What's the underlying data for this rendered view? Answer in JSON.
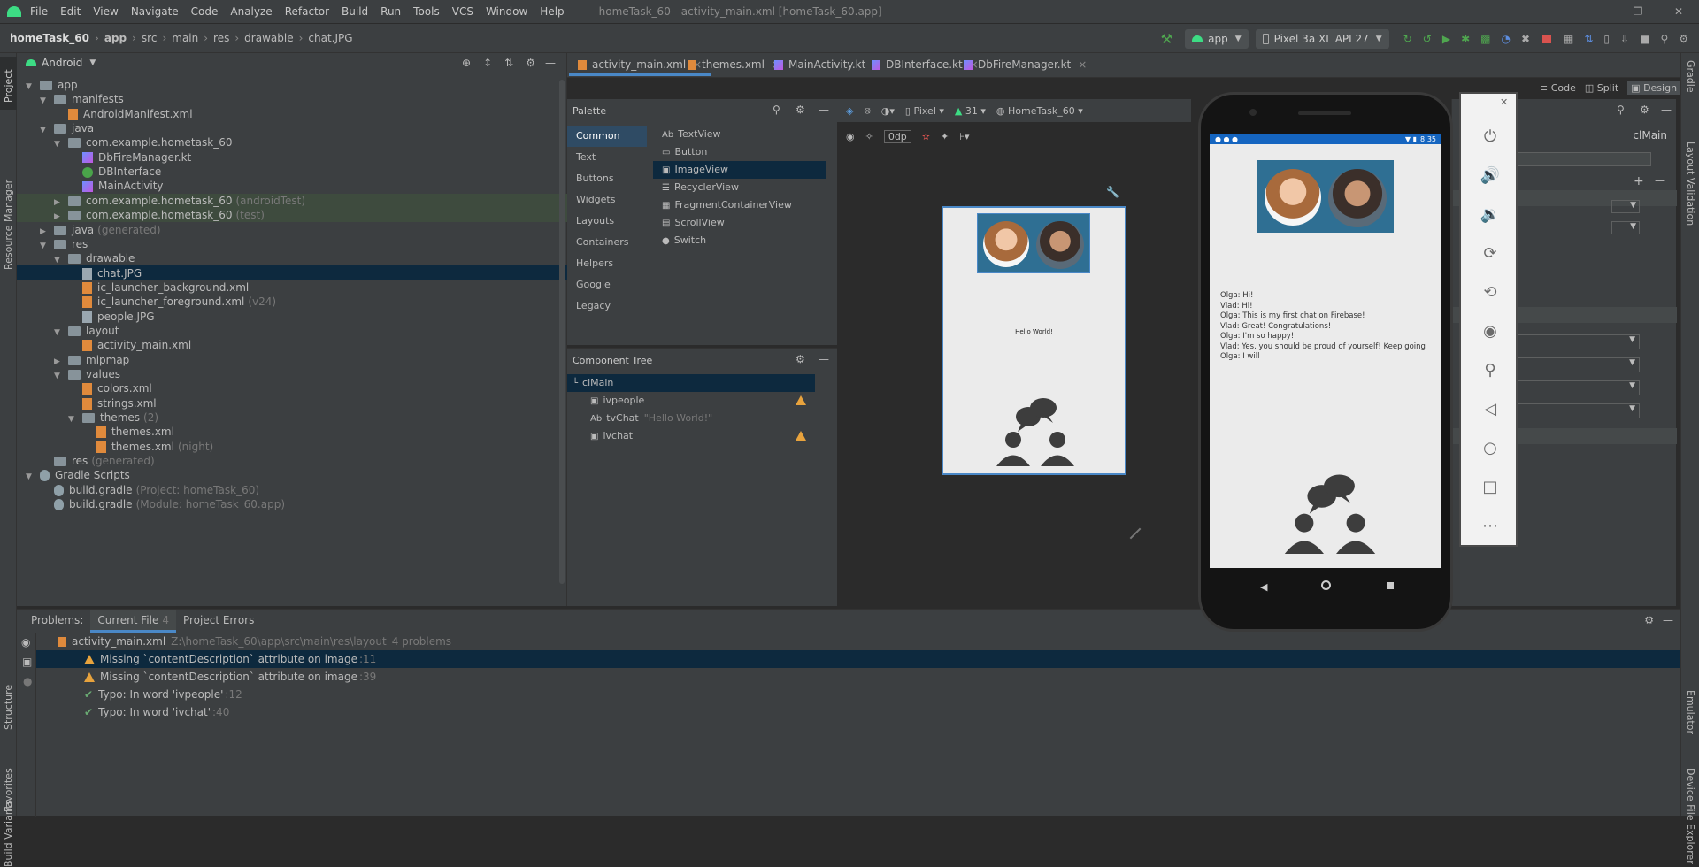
{
  "window": {
    "title": "homeTask_60 - activity_main.xml [homeTask_60.app]",
    "menu": [
      "File",
      "Edit",
      "View",
      "Navigate",
      "Code",
      "Analyze",
      "Refactor",
      "Build",
      "Run",
      "Tools",
      "VCS",
      "Window",
      "Help"
    ]
  },
  "breadcrumb": [
    "homeTask_60",
    "app",
    "src",
    "main",
    "res",
    "drawable",
    "chat.JPG"
  ],
  "toolbar": {
    "run_config": "app",
    "device": "Pixel 3a XL API 27"
  },
  "sidebar_left": [
    "Project",
    "Resource Manager",
    "Structure",
    "Favorites",
    "Build Variants"
  ],
  "sidebar_right": [
    "Gradle",
    "Layout Validation",
    "Emulator",
    "Device File Explorer"
  ],
  "project": {
    "view": "Android",
    "items": [
      {
        "label": "app",
        "depth": 0,
        "kind": "folder",
        "arrow": "down"
      },
      {
        "label": "manifests",
        "depth": 1,
        "kind": "folder",
        "arrow": "down"
      },
      {
        "label": "AndroidManifest.xml",
        "depth": 2,
        "kind": "xml"
      },
      {
        "label": "java",
        "depth": 1,
        "kind": "folder",
        "arrow": "down"
      },
      {
        "label": "com.example.hometask_60",
        "depth": 2,
        "kind": "folder",
        "arrow": "down"
      },
      {
        "label": "DbFireManager.kt",
        "depth": 3,
        "kind": "kt"
      },
      {
        "label": "DBInterface",
        "depth": 3,
        "kind": "iface"
      },
      {
        "label": "MainActivity",
        "depth": 3,
        "kind": "kt"
      },
      {
        "label": "com.example.hometask_60",
        "suffix": "(androidTest)",
        "depth": 2,
        "kind": "folder",
        "arrow": "right",
        "hl": true
      },
      {
        "label": "com.example.hometask_60",
        "suffix": "(test)",
        "depth": 2,
        "kind": "folder",
        "arrow": "right",
        "hl": true
      },
      {
        "label": "java",
        "suffix": "(generated)",
        "depth": 1,
        "kind": "folder",
        "arrow": "right"
      },
      {
        "label": "res",
        "depth": 1,
        "kind": "folder",
        "arrow": "down"
      },
      {
        "label": "drawable",
        "depth": 2,
        "kind": "folder",
        "arrow": "down"
      },
      {
        "label": "chat.JPG",
        "depth": 3,
        "kind": "file",
        "sel": true
      },
      {
        "label": "ic_launcher_background.xml",
        "depth": 3,
        "kind": "xml"
      },
      {
        "label": "ic_launcher_foreground.xml",
        "suffix": "(v24)",
        "depth": 3,
        "kind": "xml"
      },
      {
        "label": "people.JPG",
        "depth": 3,
        "kind": "file"
      },
      {
        "label": "layout",
        "depth": 2,
        "kind": "folder",
        "arrow": "down"
      },
      {
        "label": "activity_main.xml",
        "depth": 3,
        "kind": "xml"
      },
      {
        "label": "mipmap",
        "depth": 2,
        "kind": "folder",
        "arrow": "right"
      },
      {
        "label": "values",
        "depth": 2,
        "kind": "folder",
        "arrow": "down"
      },
      {
        "label": "colors.xml",
        "depth": 3,
        "kind": "xml"
      },
      {
        "label": "strings.xml",
        "depth": 3,
        "kind": "xml"
      },
      {
        "label": "themes",
        "suffix": "(2)",
        "depth": 3,
        "kind": "folder",
        "arrow": "down"
      },
      {
        "label": "themes.xml",
        "depth": 4,
        "kind": "xml"
      },
      {
        "label": "themes.xml",
        "suffix": "(night)",
        "depth": 4,
        "kind": "xml"
      },
      {
        "label": "res",
        "suffix": "(generated)",
        "depth": 1,
        "kind": "folder"
      },
      {
        "label": "Gradle Scripts",
        "depth": 0,
        "kind": "gradle",
        "arrow": "down"
      },
      {
        "label": "build.gradle",
        "suffix": "(Project: homeTask_60)",
        "depth": 1,
        "kind": "gradle"
      },
      {
        "label": "build.gradle",
        "suffix": "(Module: homeTask_60.app)",
        "depth": 1,
        "kind": "gradle"
      }
    ]
  },
  "editor_tabs": [
    {
      "label": "activity_main.xml",
      "active": true
    },
    {
      "label": "themes.xml"
    },
    {
      "label": "MainActivity.kt"
    },
    {
      "label": "DBInterface.kt"
    },
    {
      "label": "DbFireManager.kt"
    }
  ],
  "view_modes": {
    "code": "Code",
    "split": "Split",
    "design": "Design"
  },
  "palette": {
    "title": "Palette",
    "categories": [
      "Common",
      "Text",
      "Buttons",
      "Widgets",
      "Layouts",
      "Containers",
      "Helpers",
      "Google",
      "Legacy"
    ],
    "items": [
      {
        "prefix": "Ab",
        "label": "TextView"
      },
      {
        "prefix": "",
        "label": "Button"
      },
      {
        "prefix": "",
        "label": "ImageView",
        "sel": true
      },
      {
        "prefix": "",
        "label": "RecyclerView"
      },
      {
        "prefix": "",
        "label": "FragmentContainerView"
      },
      {
        "prefix": "",
        "label": "ScrollView"
      },
      {
        "prefix": "",
        "label": "Switch"
      }
    ]
  },
  "design_toolbar": {
    "device": "Pixel",
    "api": "31",
    "theme": "HomeTask_60",
    "margin": "0dp"
  },
  "component_tree": {
    "title": "Component Tree",
    "items": [
      {
        "label": "clMain",
        "depth": 0
      },
      {
        "label": "ivpeople",
        "depth": 1,
        "warn": true
      },
      {
        "label": "tvChat",
        "extra": "\"Hello World!\"",
        "depth": 1,
        "prefix": "Ab"
      },
      {
        "label": "ivchat",
        "depth": 1,
        "warn": true
      }
    ]
  },
  "design_surface": {
    "hello_text": "Hello World!"
  },
  "attributes": {
    "id": "clMain"
  },
  "phone": {
    "time": "8:35",
    "chat_lines": [
      "Olga: Hi!",
      "Vlad: Hi!",
      "Olga: This is my first chat on Firebase!",
      "Vlad: Great! Congratulations!",
      "Olga: I'm so happy!",
      "Vlad: Yes, you should be proud of yourself! Keep going",
      "Olga: I will"
    ]
  },
  "problems": {
    "tabs": [
      {
        "label": "Problems:"
      },
      {
        "label": "Current File",
        "count": "4",
        "active": true
      },
      {
        "label": "Project Errors"
      }
    ],
    "file": "activity_main.xml",
    "path": "Z:\\homeTask_60\\app\\src\\main\\res\\layout",
    "summary": "4 problems",
    "items": [
      {
        "type": "warn",
        "text": "Missing `contentDescription` attribute on image",
        "line": ":11",
        "sel": true
      },
      {
        "type": "warn",
        "text": "Missing `contentDescription` attribute on image",
        "line": ":39"
      },
      {
        "type": "typo",
        "text": "Typo: In word 'ivpeople'",
        "line": ":12"
      },
      {
        "type": "typo",
        "text": "Typo: In word 'ivchat'",
        "line": ":40"
      }
    ]
  },
  "colors": {
    "accent": "#4a88c7",
    "selection": "#0d293e",
    "warning": "#e8a33d",
    "phone_header": "#1565c0"
  }
}
